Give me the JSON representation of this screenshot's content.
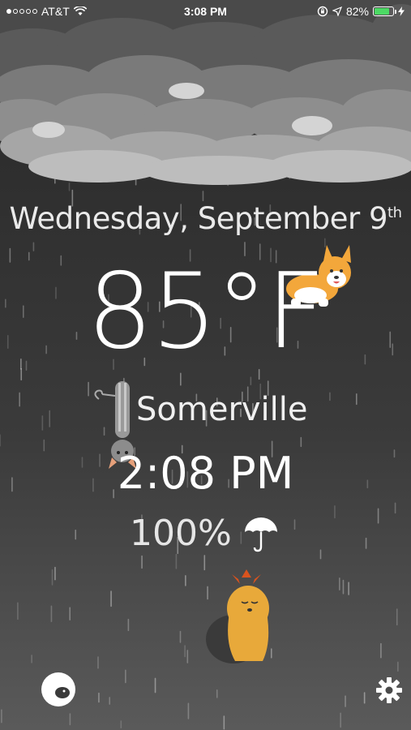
{
  "status_bar": {
    "carrier": "AT&T",
    "time": "3:08 PM",
    "battery": "82%",
    "battery_level": 0.82,
    "battery_color": "#4cd964",
    "signal_bars": 1,
    "signal_total": 5
  },
  "weather": {
    "weekday_month": "Wednesday, September 9",
    "day_suffix": "th",
    "temperature": "85°F",
    "city": "Somerville",
    "time": "2:08 PM",
    "precipitation": "100%"
  },
  "icons": {
    "umbrella": "umbrella-icon",
    "settings": "gear-icon",
    "app": "app-logo-icon",
    "wifi": "wifi-icon",
    "location": "location-arrow-icon",
    "lock_rotation": "rotation-lock-icon",
    "charging": "charging-bolt-icon"
  },
  "colors": {
    "corgi": "#f3a73b",
    "yorkie": "#e8a93a",
    "cat": "#9a9a9a"
  }
}
